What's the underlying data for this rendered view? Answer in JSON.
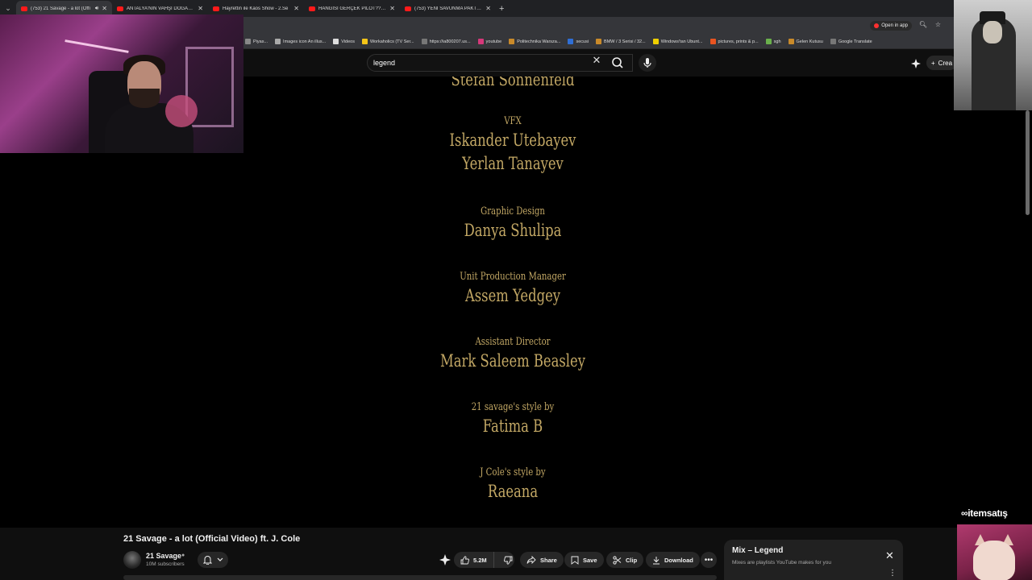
{
  "browser": {
    "tabs": [
      {
        "label": "(753) 21 Savage - a lot (Offi",
        "active": true,
        "audio": true
      },
      {
        "label": "ANTALYA'NIN VAHŞİ DOĞASIN",
        "active": false
      },
      {
        "label": "Hayrettin ile Kaos Show - 2.Se",
        "active": false
      },
      {
        "label": "HANGİSİ GERÇEK PİLOT?? ft. @",
        "active": false
      },
      {
        "label": "(753) YENİ SAVUNMA PAKTI: İS",
        "active": false
      }
    ],
    "open_in_app": "Open in app",
    "bookmarks": [
      "Piyas...",
      "Images icon An illus...",
      "Videos",
      "Workaholics (TV Ser...",
      "https://ia800207.us...",
      "youtube",
      "Politechnika Warsza...",
      "secusi",
      "BMW / 3 Serisi / 32...",
      "Windows'tan Ubunt...",
      "pictures, prints & p...",
      "sgh",
      "Gelen Kutusu",
      "Google Translate"
    ]
  },
  "youtube": {
    "search_value": "legend",
    "create_label": "Crea"
  },
  "credits": [
    {
      "role": "",
      "names": [
        "Stefan Sonnenfeld"
      ],
      "partial": true
    },
    {
      "role": "VFX",
      "names": [
        "Iskander Utebayev",
        "Yerlan Tanayev"
      ]
    },
    {
      "role": "Graphic Design",
      "names": [
        "Danya Shulipa"
      ]
    },
    {
      "role": "Unit Production Manager",
      "names": [
        "Assem Yedgey"
      ]
    },
    {
      "role": "Assistant Director",
      "names": [
        "Mark Saleem Beasley"
      ]
    },
    {
      "role": "21 savage's style by",
      "names": [
        "Fatima B"
      ]
    },
    {
      "role": "J Cole's style by",
      "names": [
        "Raeana"
      ]
    }
  ],
  "video": {
    "title": "21 Savage - a lot (Official Video) ft. J. Cole",
    "channel": "21 Savage",
    "subscribers": "10M subscribers",
    "likes": "5.2M",
    "share_label": "Share",
    "save_label": "Save",
    "clip_label": "Clip",
    "download_label": "Download"
  },
  "mix": {
    "title": "Mix – Legend",
    "subtitle": "Mixes are playlists YouTube makes for you"
  },
  "watermark": "itemsatış",
  "colors": {
    "credit_gold": "#c3a865",
    "yt_red": "#ff0000",
    "bg": "#000000"
  }
}
